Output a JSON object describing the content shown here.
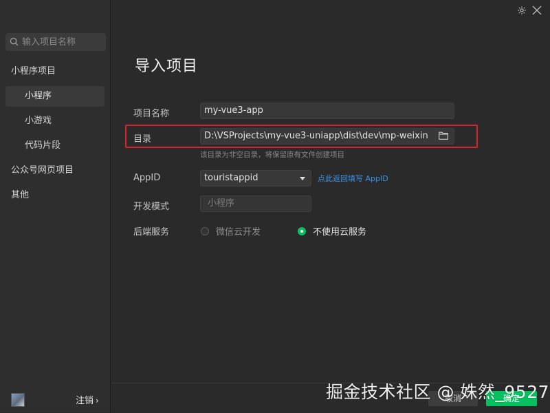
{
  "search": {
    "placeholder": "输入项目名称",
    "icon": "search-icon"
  },
  "sidebar": {
    "items": [
      {
        "label": "小程序项目",
        "type": "group"
      },
      {
        "label": "小程序",
        "type": "sub",
        "active": true
      },
      {
        "label": "小游戏",
        "type": "sub"
      },
      {
        "label": "代码片段",
        "type": "sub"
      },
      {
        "label": "公众号网页项目",
        "type": "group"
      },
      {
        "label": "其他",
        "type": "group"
      }
    ],
    "logout_label": "注销",
    "logout_chevron": "›"
  },
  "header": {
    "settings_icon": "gear-icon",
    "close_icon": "close-icon"
  },
  "page": {
    "title": "导入项目"
  },
  "form": {
    "project_name_label": "项目名称",
    "project_name_value": "my-vue3-app",
    "directory_label": "目录",
    "directory_value": "D:\\VSProjects\\my-vue3-uniapp\\dist\\dev\\mp-weixin",
    "directory_hint": "该目录为非空目录，将保留原有文件创建项目",
    "appid_label": "AppID",
    "appid_value": "touristappid",
    "appid_link": "点此返回填写 AppID",
    "dev_mode_label": "开发模式",
    "dev_mode_value": "小程序",
    "backend_label": "后端服务",
    "backend_options": [
      {
        "label": "微信云开发",
        "selected": false
      },
      {
        "label": "不使用云服务",
        "selected": true
      }
    ]
  },
  "buttons": {
    "cancel": "取消",
    "confirm": "确定"
  },
  "watermark": "掘金技术社区 @ 姝然_9527",
  "colors": {
    "accent": "#07c160",
    "link": "#3a93e8",
    "highlight": "#d8232a"
  }
}
